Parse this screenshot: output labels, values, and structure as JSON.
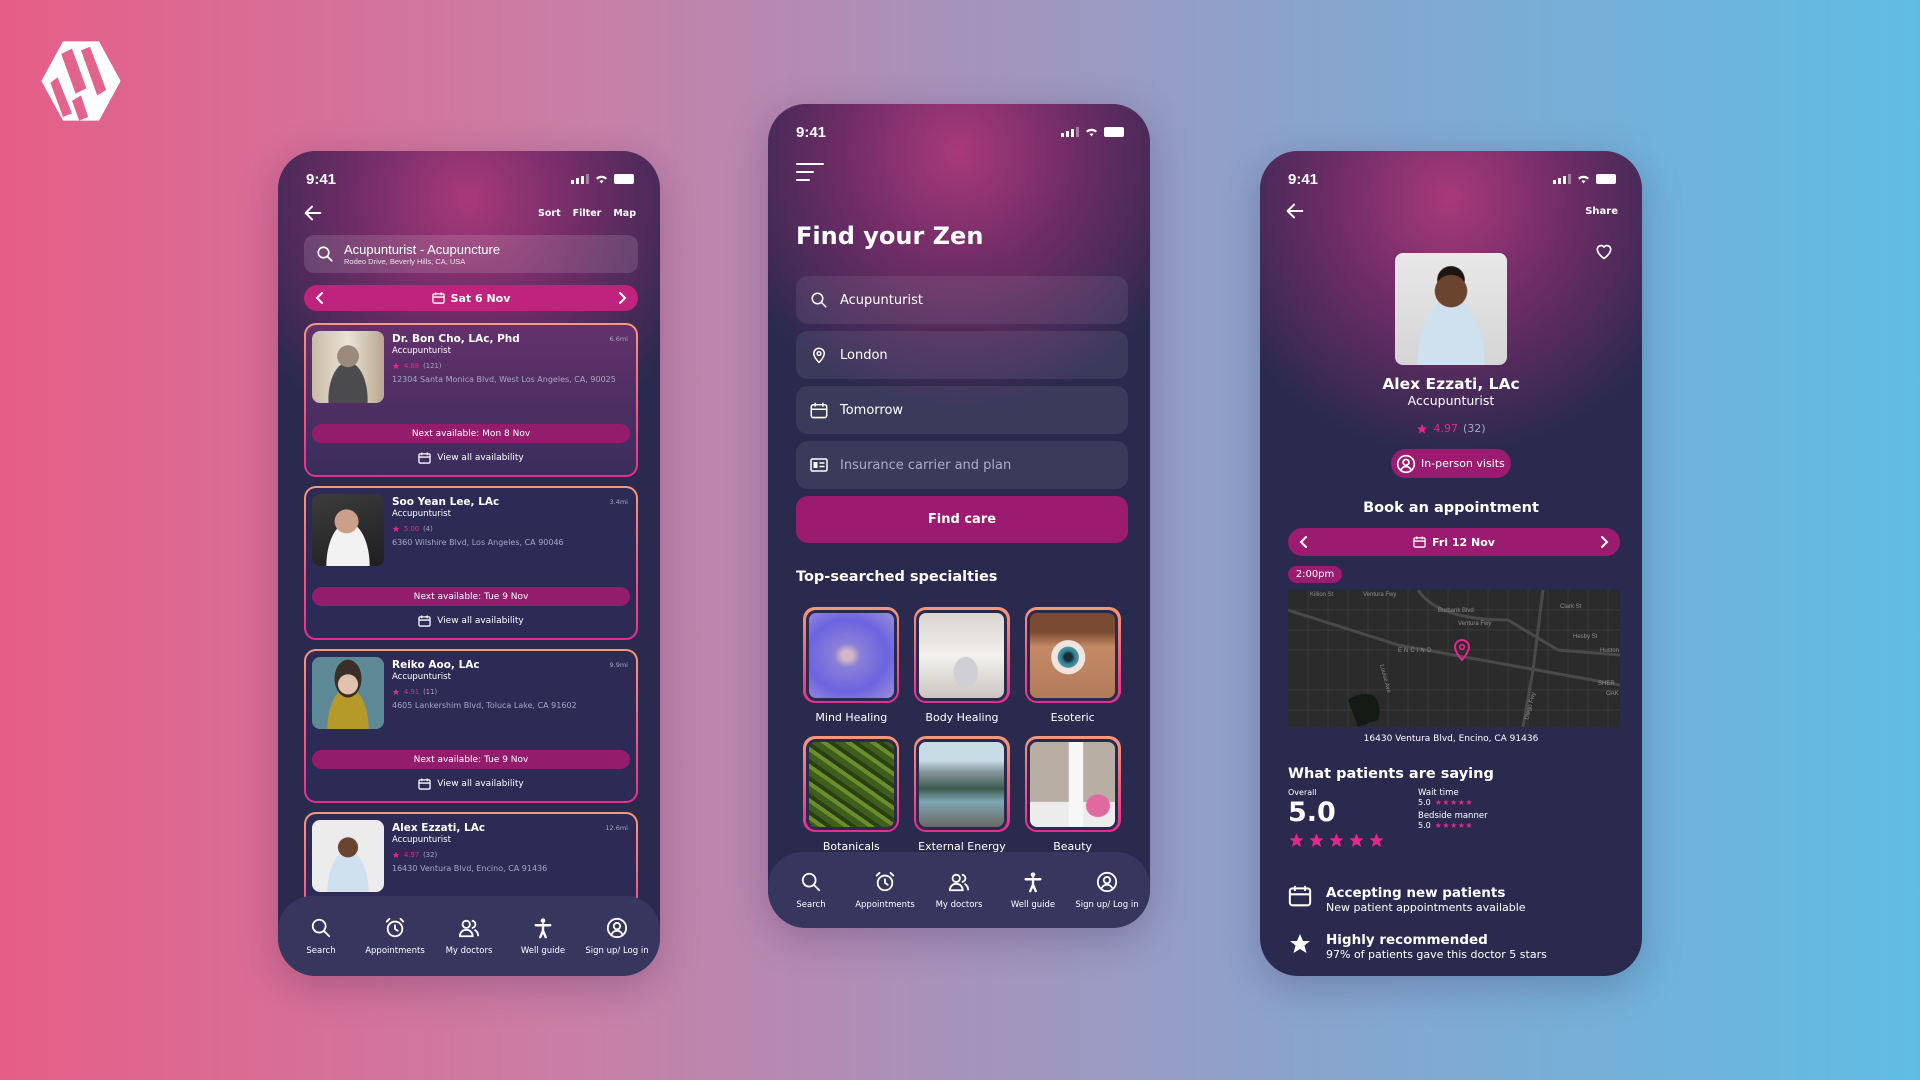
{
  "brand": {
    "logo_icon": "hexagon-hv-logo-icon"
  },
  "colors": {
    "accent": "#e8258f",
    "primary_button": "#9a1b6f",
    "date_bar": "#c0237e",
    "phone_bg": "#2a2a4e",
    "nav_bg": "#37365e"
  },
  "status_bar": {
    "time": "9:41"
  },
  "left_screen": {
    "header": {
      "back_icon": "arrow-left-icon",
      "actions": [
        "Sort",
        "Filter",
        "Map"
      ]
    },
    "search": {
      "title": "Acupunturist - Acupuncture",
      "subtitle": "Rodeo Drive, Beverly Hills, CA, USA"
    },
    "date_bar": {
      "label": "Sat 6 Nov"
    },
    "doctors": [
      {
        "name": "Dr. Bon Cho, LAc, Phd",
        "specialty": "Accupunturist",
        "rating": "4.88",
        "reviews": "(121)",
        "address": "12304 Santa Monica Blvd, West Los Angeles, CA, 90025",
        "distance": "6.6mi",
        "next_available": "Next available: Mon 8 Nov",
        "view_all": "View all availability"
      },
      {
        "name": "Soo Yean Lee, LAc",
        "specialty": "Accupunturist",
        "rating": "5.00",
        "reviews": "(4)",
        "address": "6360 Wilshire Blvd, Los Angeles, CA 90046",
        "distance": "3.4mi",
        "next_available": "Next available: Tue 9 Nov",
        "view_all": "View all availability"
      },
      {
        "name": "Reiko Aoo, LAc",
        "specialty": "Accupunturist",
        "rating": "4.91",
        "reviews": "(11)",
        "address": "4605 Lankershim Blvd, Toluca Lake, CA 91602",
        "distance": "9.9mi",
        "next_available": "Next available: Tue 9 Nov",
        "view_all": "View all availability"
      },
      {
        "name": "Alex Ezzati, LAc",
        "specialty": "Accupunturist",
        "rating": "4.97",
        "reviews": "(32)",
        "address": "16430 Ventura Blvd, Encino, CA 91436",
        "distance": "12.6mi",
        "next_available": "",
        "view_all": ""
      }
    ]
  },
  "nav": [
    {
      "label": "Search",
      "icon": "search-icon"
    },
    {
      "label": "Appointments",
      "icon": "alarm-clock-icon"
    },
    {
      "label": "My doctors",
      "icon": "users-icon"
    },
    {
      "label": "Well guide",
      "icon": "person-standing-icon"
    },
    {
      "label": "Sign up/ Log in",
      "icon": "user-circle-icon"
    }
  ],
  "middle_screen": {
    "title": "Find your Zen",
    "fields": [
      {
        "icon": "search-icon",
        "value": "Acupunturist",
        "placeholder": ""
      },
      {
        "icon": "location-pin-icon",
        "value": "London",
        "placeholder": ""
      },
      {
        "icon": "calendar-icon",
        "value": "Tomorrow",
        "placeholder": ""
      },
      {
        "icon": "id-card-icon",
        "value": "",
        "placeholder": "Insurance carrier and plan"
      }
    ],
    "find_button": "Find care",
    "specialties_title": "Top-searched specialties",
    "specialties": [
      "Mind Healing",
      "Body Healing",
      "Esoteric",
      "Botanicals",
      "External Energy",
      "Beauty"
    ]
  },
  "right_screen": {
    "share": "Share",
    "name": "Alex Ezzati, LAc",
    "specialty": "Accupunturist",
    "rating": "4.97",
    "reviews": "(32)",
    "visit_type": "In-person visits",
    "book_title": "Book an appointment",
    "date": "Fri 12 Nov",
    "time_slot": "2:00pm",
    "map_labels": [
      "Killion St",
      "Ventura Fwy",
      "Burbank Blvd",
      "Ventura Fwy",
      "Clark St",
      "Hesby St",
      "Huston",
      "ENCINO",
      "Louise Ave",
      "Diego Fwy",
      "SHER",
      "OAK"
    ],
    "address": "16430 Ventura Blvd, Encino, CA 91436",
    "reviews_title": "What patients are saying",
    "overall_label": "Overall",
    "overall_score": "5.0",
    "overall_stars": 5,
    "sub_ratings": [
      {
        "label": "Wait time",
        "score": "5.0",
        "stars": 5
      },
      {
        "label": "Bedside manner",
        "score": "5.0",
        "stars": 5
      }
    ],
    "features": [
      {
        "icon": "calendar-icon",
        "title": "Accepting new patients",
        "desc": "New patient appointments available"
      },
      {
        "icon": "star-icon",
        "title": "Highly recommended",
        "desc": "97% of patients gave this doctor 5 stars"
      }
    ]
  }
}
